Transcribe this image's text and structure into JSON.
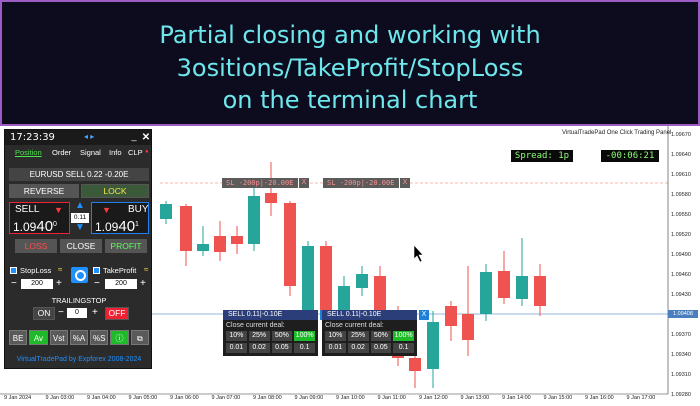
{
  "banner": {
    "line1": "Partial closing and working with",
    "line2": "3ositions/TakeProfit/StopLoss",
    "line3": "on the terminal chart"
  },
  "chart": {
    "panel_title": "VirtualTradePad One Click Trading Panel",
    "spread": "Spread: 1p",
    "timer": "-00:06:21",
    "sl_tag_1": "SL -200p|-20.00E",
    "sl_tag_2": "SL -200p|-20.00E",
    "sl_x": "X",
    "price_labels": [
      "1.09670",
      "1.09640",
      "1.09610",
      "1.09580",
      "1.09550",
      "1.09520",
      "1.09490",
      "1.09460",
      "1.09430",
      "1.09400",
      "1.09370",
      "1.09340",
      "1.09310",
      "1.09280"
    ],
    "current_price": "1.09408",
    "time_labels": [
      "9 Jan 2024",
      "9 Jan 03:00",
      "9 Jan 04:00",
      "9 Jan 05:00",
      "9 Jan 06:00",
      "9 Jan 07:00",
      "9 Jan 08:00",
      "9 Jan 09:00",
      "9 Jan 10:00",
      "9 Jan 11:00",
      "9 Jan 12:00",
      "9 Jan 13:00",
      "9 Jan 14:00",
      "9 Jan 15:00",
      "9 Jan 16:00",
      "9 Jan 17:00"
    ],
    "colors": {
      "bull": "#26a69a",
      "bear": "#ef5350",
      "sl_line": "#f4a48c",
      "price_line": "#6fa0d0"
    }
  },
  "deals": [
    {
      "header": "SELL 0.11|-0.10E",
      "close_x": "X",
      "subtitle": "Close current deal:",
      "pct": [
        "10%",
        "25%",
        "50%",
        "100%"
      ],
      "lots": [
        "0.01",
        "0.02",
        "0.05",
        "0.1"
      ]
    },
    {
      "header": "SELL 0.11|-0.10E",
      "close_x": "X",
      "subtitle": "Close current deal:",
      "pct": [
        "10%",
        "25%",
        "50%",
        "100%"
      ],
      "lots": [
        "0.01",
        "0.02",
        "0.05",
        "0.1"
      ]
    }
  ],
  "panel": {
    "time": "17:23:39",
    "arrows": "◂ ▸",
    "minimize": "_",
    "close": "✕",
    "tabs": [
      "Position",
      "Order",
      "Signal",
      "Info",
      "CLP"
    ],
    "tab_dot": "●",
    "symbol": "EURUSD SELL 0.22 -0.20E",
    "reverse": "REVERSE",
    "lock": "LOCK",
    "sell_label": "SELL",
    "sell_price": "1.09",
    "sell_big": "40",
    "sell_sup": "0",
    "buy_label": "BUY",
    "buy_price": "1.09",
    "buy_big": "40",
    "buy_sup": "1",
    "lot": "0.11",
    "loss": "LOSS",
    "close_btn": "CLOSE",
    "profit": "PROFIT",
    "stoploss_label": "StopLoss",
    "stoploss_value": "200",
    "takeprofit_label": "TakeProfit",
    "takeprofit_value": "200",
    "trailing_label": "TRAILINGSTOP",
    "on": "ON",
    "trail_value": "0",
    "off": "OFF",
    "bottom": [
      "BE",
      "Av",
      "Vst",
      "%A",
      "%S",
      "ⓘ",
      "⧉"
    ],
    "footer": "VirtualTradePad by Expforex 2008-2024"
  }
}
